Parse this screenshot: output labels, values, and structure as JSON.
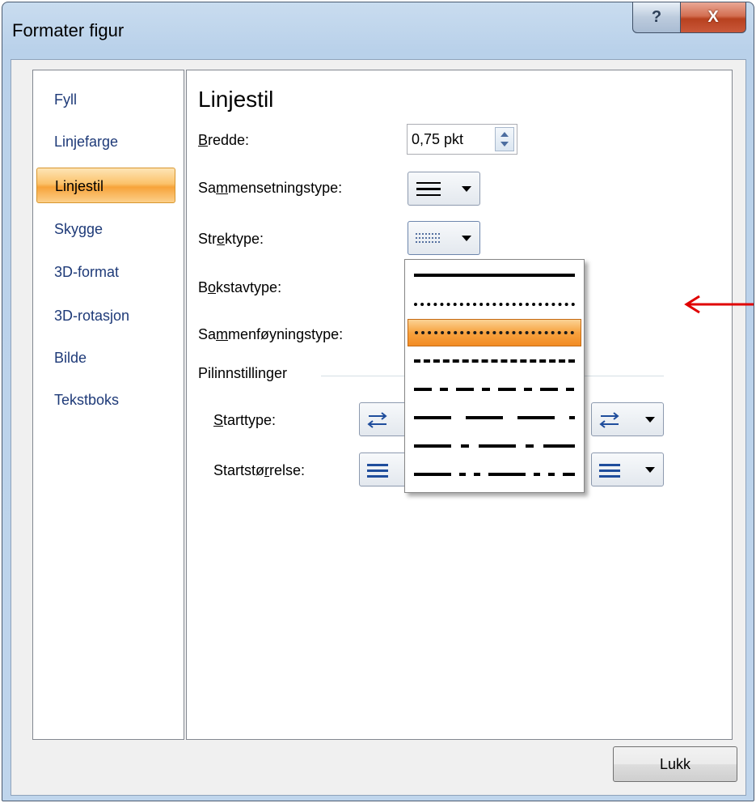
{
  "window": {
    "title": "Formater figur",
    "help_label": "?",
    "close_label": "X"
  },
  "nav": {
    "items": [
      {
        "label": "Fyll"
      },
      {
        "label": "Linjefarge"
      },
      {
        "label": "Linjestil",
        "selected": true
      },
      {
        "label": "Skygge"
      },
      {
        "label": "3D-format"
      },
      {
        "label": "3D-rotasjon"
      },
      {
        "label": "Bilde"
      },
      {
        "label": "Tekstboks"
      }
    ]
  },
  "content": {
    "heading": "Linjestil",
    "bredde": {
      "label_mnemonic": "B",
      "label_rest": "redde:",
      "value": "0,75 pkt"
    },
    "sammensetningstype": {
      "label_pre": "Sa",
      "label_mnemonic": "m",
      "label_rest": "mensetningstype:",
      "icon": "compound-line-icon"
    },
    "strektype": {
      "label_pre": "Str",
      "label_mnemonic": "e",
      "label_rest": "ktype:",
      "icon": "dash-type-icon"
    },
    "bokstavtype": {
      "label_pre": "B",
      "label_mnemonic": "o",
      "label_rest": "kstavtype:"
    },
    "sammenfoyningstype": {
      "label_pre": "Sa",
      "label_mnemonic": "m",
      "label_rest": "menføyningstype:"
    },
    "pilinnstillinger": {
      "group_label": "Pilinnstillinger",
      "starttype": {
        "label_mnemonic": "S",
        "label_rest": "tarttype:"
      },
      "startstorrelse": {
        "label_pre": "Startstø",
        "label_mnemonic": "r",
        "label_rest": "relse:"
      }
    }
  },
  "dash_dropdown": {
    "options": [
      {
        "name": "solid"
      },
      {
        "name": "round-dot"
      },
      {
        "name": "square-dot",
        "selected": true
      },
      {
        "name": "dash"
      },
      {
        "name": "dash-dot"
      },
      {
        "name": "long-dash"
      },
      {
        "name": "long-dash-dot"
      },
      {
        "name": "long-dash-dot-dot"
      }
    ]
  },
  "footer": {
    "close_button": "Lukk"
  },
  "colors": {
    "accent_selected": "#f7a23f",
    "annotation_arrow": "#e00000",
    "nav_text": "#1e3a78"
  }
}
